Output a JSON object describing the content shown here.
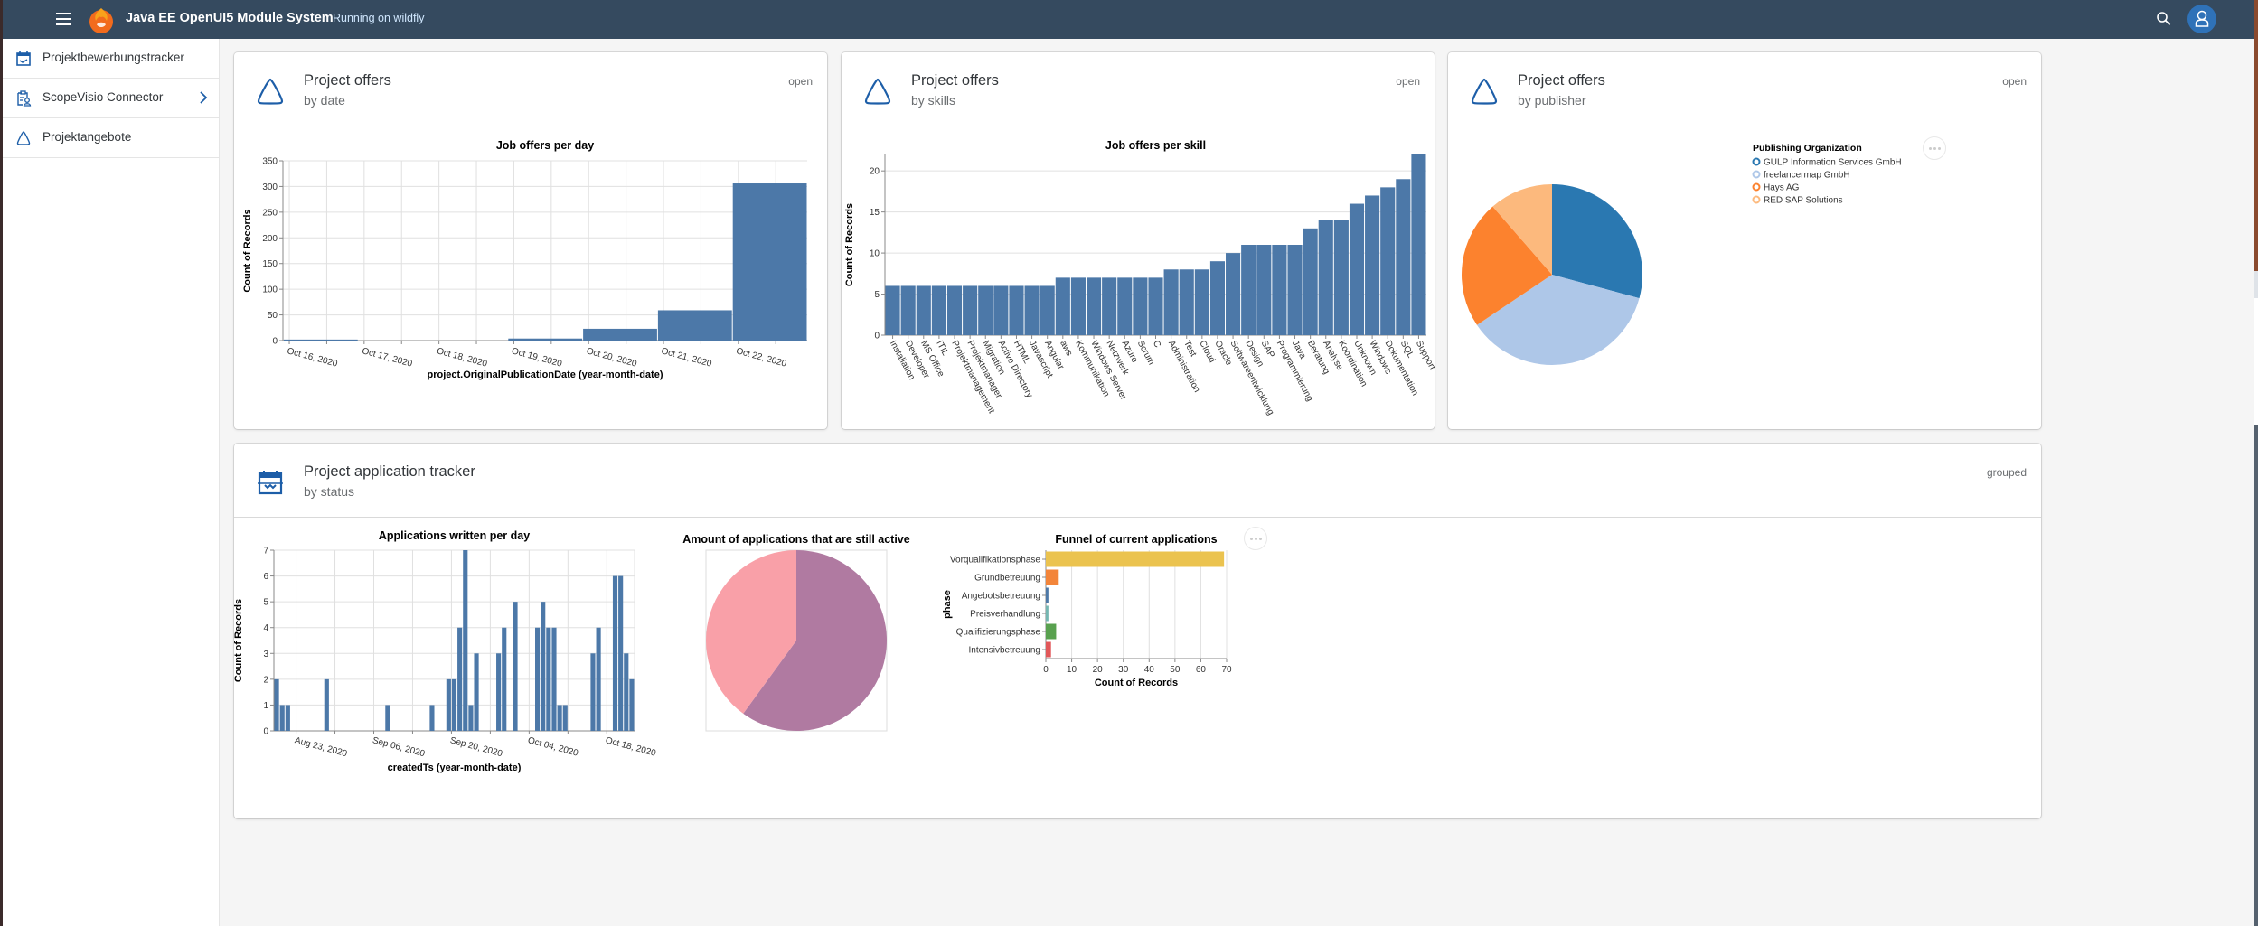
{
  "shell": {
    "menu_icon": "hamburger-icon",
    "logo": "phoenix-logo",
    "title": "Java EE OpenUI5 Module System",
    "subtitle": "Running on wildfly",
    "search_icon": "search-icon",
    "avatar_icon": "user-icon",
    "colors": {
      "bar": "#354a5f",
      "avatar": "#2f72b8"
    }
  },
  "sidebar": {
    "items": [
      {
        "label": "Projektbewerbungstracker",
        "icon": "calendar-icon"
      },
      {
        "label": "ScopeVisio Connector",
        "icon": "clipboard-user-icon",
        "has_children": true
      },
      {
        "label": "Projektangebote",
        "icon": "triangle-icon"
      }
    ]
  },
  "cards": [
    {
      "title": "Project offers",
      "subtitle": "by date",
      "status": "open",
      "icon": "triangle-icon"
    },
    {
      "title": "Project offers",
      "subtitle": "by skills",
      "status": "open",
      "icon": "triangle-icon"
    },
    {
      "title": "Project offers",
      "subtitle": "by publisher",
      "status": "open",
      "icon": "triangle-icon"
    },
    {
      "title": "Project application tracker",
      "subtitle": "by status",
      "status": "grouped",
      "icon": "calendar-icon"
    }
  ],
  "chart_data": [
    {
      "type": "bar",
      "title": "Job offers per day",
      "xlabel": "project.OriginalPublicationDate (year-month-date)",
      "ylabel": "Count of Records",
      "x": [
        "2020-10-16",
        "2020-10-17",
        "2020-10-18",
        "2020-10-19",
        "2020-10-20",
        "2020-10-21",
        "2020-10-22"
      ],
      "tick_labels": [
        "Oct 16, 2020",
        "Oct 17, 2020",
        "Oct 18, 2020",
        "Oct 19, 2020",
        "Oct 20, 2020",
        "Oct 21, 2020",
        "Oct 22, 2020"
      ],
      "values": [
        2,
        0,
        0,
        4,
        23,
        59,
        306
      ],
      "ylim": [
        0,
        350
      ],
      "yticks": [
        0,
        50,
        100,
        150,
        200,
        250,
        300,
        350
      ],
      "grid": true,
      "color": "#4c78a8"
    },
    {
      "type": "bar",
      "title": "Job offers per skill",
      "xlabel": "",
      "ylabel": "Count of Records",
      "categories": [
        "Installation",
        "Developer",
        "MS Office",
        "ITIL",
        "Projektmanagement",
        "Projektmanager",
        "Migration",
        "Active Directory",
        "HTML",
        "Javascript",
        "Angular",
        "aws",
        "Kommunikation",
        "Windows Server",
        "Netzwerk",
        "Azure",
        "Scrum",
        "C",
        "Administration",
        "Test",
        "Cloud",
        "Oracle",
        "Softwareentwicklung",
        "Design",
        "SAP",
        "Programmierung",
        "Java",
        "Beratung",
        "Analyse",
        "Koordination",
        "Unknown",
        "Windows",
        "Dokumentation",
        "SQL",
        "Support"
      ],
      "values": [
        6,
        6,
        6,
        6,
        6,
        6,
        6,
        6,
        6,
        6,
        6,
        7,
        7,
        7,
        7,
        7,
        7,
        7,
        8,
        8,
        8,
        9,
        10,
        11,
        11,
        11,
        11,
        13,
        14,
        14,
        16,
        17,
        18,
        19,
        22
      ],
      "ylim": [
        0,
        22
      ],
      "yticks": [
        0,
        5,
        10,
        15,
        20
      ],
      "grid": true,
      "color": "#4c78a8"
    },
    {
      "type": "pie",
      "legend_title": "Publishing Organization",
      "legend_position": "top-right",
      "categories": [
        "GULP Information Services GmbH",
        "freelancermap GmbH",
        "Hays AG",
        "RED SAP Solutions"
      ],
      "values": [
        29.2,
        36.4,
        23.0,
        11.4
      ],
      "colors": [
        "#2a78b1",
        "#aec7e8",
        "#fc822e",
        "#fcb97d"
      ]
    },
    {
      "type": "bar",
      "title": "Applications written per day",
      "xlabel": "createdTs (year-month-date)",
      "ylabel": "Count of Records",
      "x": [
        "2020-08-19",
        "2020-08-20",
        "2020-08-21",
        "2020-08-28",
        "2020-09-08",
        "2020-09-16",
        "2020-09-19",
        "2020-09-20",
        "2020-09-21",
        "2020-09-22",
        "2020-09-23",
        "2020-09-24",
        "2020-09-28",
        "2020-09-29",
        "2020-10-01",
        "2020-10-05",
        "2020-10-06",
        "2020-10-07",
        "2020-10-08",
        "2020-10-09",
        "2020-10-10",
        "2020-10-15",
        "2020-10-16",
        "2020-10-19",
        "2020-10-20",
        "2020-10-21",
        "2020-10-22"
      ],
      "values": [
        2,
        1,
        1,
        2,
        1,
        1,
        2,
        2,
        4,
        7,
        1,
        3,
        3,
        4,
        5,
        4,
        5,
        4,
        4,
        1,
        1,
        3,
        4,
        6,
        6,
        3,
        2
      ],
      "tick_labels": [
        "Aug 23, 2020",
        "Sep 06, 2020",
        "Sep 20, 2020",
        "Oct 04, 2020",
        "Oct 18, 2020"
      ],
      "tick_dates": [
        "2020-08-23",
        "2020-09-06",
        "2020-09-20",
        "2020-10-04",
        "2020-10-18"
      ],
      "ylim": [
        0,
        7
      ],
      "yticks": [
        0,
        1,
        2,
        3,
        4,
        5,
        6,
        7
      ],
      "grid": true,
      "color": "#4c78a8"
    },
    {
      "type": "pie",
      "title": "Amount of applications that are still active",
      "values": [
        60,
        40
      ],
      "colors": [
        "#b07aa1",
        "#f9a0a8"
      ]
    },
    {
      "type": "bar",
      "orientation": "horizontal",
      "title": "Funnel of current applications",
      "xlabel": "Count of Records",
      "ylabel": "phase",
      "categories": [
        "Vorqualifikationsphase",
        "Grundbetreuung",
        "Angebotsbetreuung",
        "Preisverhandlung",
        "Qualifizierungsphase",
        "Intensivbetreuung"
      ],
      "values": [
        69,
        5,
        1,
        1,
        4,
        2
      ],
      "xlim": [
        0,
        70
      ],
      "xticks": [
        0,
        10,
        20,
        30,
        40,
        50,
        60,
        70
      ],
      "grid": true,
      "colors": [
        "#ebc34f",
        "#f3853a",
        "#4e79a7",
        "#76b7b2",
        "#59a14f",
        "#e15759"
      ]
    }
  ]
}
